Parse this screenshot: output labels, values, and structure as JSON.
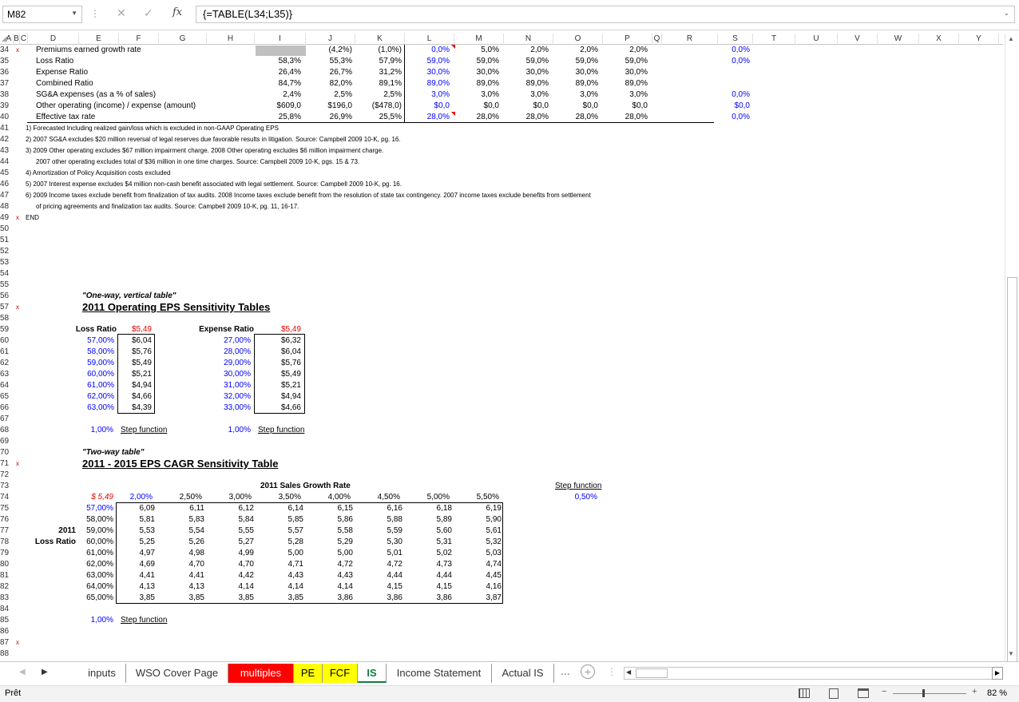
{
  "namebox": "M82",
  "formula": "{=TABLE(L34;L35)}",
  "columns": [
    "A",
    "B",
    "C",
    "D",
    "E",
    "F",
    "G",
    "H",
    "I",
    "J",
    "K",
    "L",
    "M",
    "N",
    "O",
    "P",
    "Q",
    "R",
    "S",
    "T",
    "U",
    "V",
    "W",
    "X",
    "Y"
  ],
  "rows": [
    "34",
    "35",
    "36",
    "37",
    "38",
    "39",
    "40",
    "41",
    "42",
    "43",
    "44",
    "45",
    "46",
    "47",
    "48",
    "49",
    "50",
    "51",
    "52",
    "53",
    "54",
    "55",
    "56",
    "57",
    "58",
    "59",
    "60",
    "61",
    "62",
    "63",
    "64",
    "65",
    "66",
    "67",
    "68",
    "69",
    "70",
    "71",
    "72",
    "73",
    "74",
    "75",
    "76",
    "77",
    "78",
    "79",
    "80",
    "81",
    "82",
    "83",
    "84",
    "85",
    "86",
    "87",
    "88"
  ],
  "top": {
    "r34": {
      "label": "Premiums earned growth rate",
      "j": "(4,2%)",
      "k": "(1,0%)",
      "l": "0,0%",
      "m": "5,0%",
      "n": "2,0%",
      "o": "2,0%",
      "p": "2,0%",
      "s": "0,0%"
    },
    "r35": {
      "label": "Loss Ratio",
      "i": "58,3%",
      "j": "55,3%",
      "k": "57,9%",
      "l": "59,0%",
      "m": "59,0%",
      "n": "59,0%",
      "o": "59,0%",
      "p": "59,0%",
      "s": "0,0%"
    },
    "r36": {
      "label": "Expense Ratio",
      "i": "26,4%",
      "j": "26,7%",
      "k": "31,2%",
      "l": "30,0%",
      "m": "30,0%",
      "n": "30,0%",
      "o": "30,0%",
      "p": "30,0%"
    },
    "r37": {
      "label": "Combined Ratio",
      "i": "84,7%",
      "j": "82,0%",
      "k": "89,1%",
      "l": "89,0%",
      "m": "89,0%",
      "n": "89,0%",
      "o": "89,0%",
      "p": "89,0%"
    },
    "r38": {
      "label": "SG&A expenses (as a % of sales)",
      "i": "2,4%",
      "j": "2,5%",
      "k": "2,5%",
      "l": "3,0%",
      "m": "3,0%",
      "n": "3,0%",
      "o": "3,0%",
      "p": "3,0%",
      "s": "0,0%"
    },
    "r39": {
      "label": "Other operating (income) / expense (amount)",
      "i": "$609,0",
      "j": "$196,0",
      "k": "($478,0)",
      "l": "$0,0",
      "m": "$0,0",
      "n": "$0,0",
      "o": "$0,0",
      "p": "$0,0",
      "s": "$0,0"
    },
    "r40": {
      "label": "Effective tax rate",
      "i": "25,8%",
      "j": "26,9%",
      "k": "25,5%",
      "l": "28,0%",
      "m": "28,0%",
      "n": "28,0%",
      "o": "28,0%",
      "p": "28,0%",
      "s": "0,0%"
    }
  },
  "notes": [
    "1) Forecasted Including realized gain/loss which is excluded in non-GAAP Operating EPS",
    "2) 2007 SG&A excludes $20 million reversal of legal reserves due favorable results in litigation. Source: Campbell 2009 10-K, pg. 16.",
    "3) 2009 Other operating excludes $67 million impairment charge. 2008 Other operating excludes $6 million impairment charge.",
    "2007 other operating excludes total of $36 million in one time charges.  Source: Campbell 2009 10-K, pgs. 15 & 73.",
    "4) Amortization of Policy Acquisition costs excluded",
    "5) 2007 Interest expense excludes $4 million non-cash benefit associated with legal settlement. Source: Campbell 2009 10-K, pg. 16.",
    "6) 2009 Income taxes exclude benefit from finalization of tax audits. 2008 Income taxes exclude benefit from the resolution of state tax contingency. 2007 income taxes exclude benefits from settlement",
    "of pricing agreements and finalization tax audits.  Source: Campbell 2009 10-K, pg. 11, 16-17."
  ],
  "end_label": "END",
  "oneway": {
    "caption": "\"One-way, vertical table\"",
    "title": "2011 Operating EPS Sensitivity Tables",
    "loss": {
      "header": "Loss Ratio",
      "base": "$5,49",
      "rates": [
        "57,00%",
        "58,00%",
        "59,00%",
        "60,00%",
        "61,00%",
        "62,00%",
        "63,00%"
      ],
      "values": [
        "$6,04",
        "$5,76",
        "$5,49",
        "$5,21",
        "$4,94",
        "$4,66",
        "$4,39"
      ],
      "step": "1,00%",
      "step_label": "Step function"
    },
    "expense": {
      "header": "Expense Ratio",
      "base": "$5,49",
      "rates": [
        "27,00%",
        "28,00%",
        "29,00%",
        "30,00%",
        "31,00%",
        "32,00%",
        "33,00%"
      ],
      "values": [
        "$6,32",
        "$6,04",
        "$5,76",
        "$5,49",
        "$5,21",
        "$4,94",
        "$4,66"
      ],
      "step": "1,00%",
      "step_label": "Step function"
    }
  },
  "twoway": {
    "caption": "\"Two-way table\"",
    "title": "2011 - 2015 EPS CAGR Sensitivity Table",
    "col_title": "2011 Sales Growth Rate",
    "row_title_1": "2011",
    "row_title_2": "Loss Ratio",
    "corner": "$ 5,49",
    "growth": [
      "2,00%",
      "2,50%",
      "3,00%",
      "3,50%",
      "4,00%",
      "4,50%",
      "5,00%",
      "5,50%"
    ],
    "loss": [
      "57,00%",
      "58,00%",
      "59,00%",
      "60,00%",
      "61,00%",
      "62,00%",
      "63,00%",
      "64,00%",
      "65,00%"
    ],
    "grid": [
      [
        "6,09",
        "6,11",
        "6,12",
        "6,14",
        "6,15",
        "6,16",
        "6,18",
        "6,19"
      ],
      [
        "5,81",
        "5,83",
        "5,84",
        "5,85",
        "5,86",
        "5,88",
        "5,89",
        "5,90"
      ],
      [
        "5,53",
        "5,54",
        "5,55",
        "5,57",
        "5,58",
        "5,59",
        "5,60",
        "5,61"
      ],
      [
        "5,25",
        "5,26",
        "5,27",
        "5,28",
        "5,29",
        "5,30",
        "5,31",
        "5,32"
      ],
      [
        "4,97",
        "4,98",
        "4,99",
        "5,00",
        "5,00",
        "5,01",
        "5,02",
        "5,03"
      ],
      [
        "4,69",
        "4,70",
        "4,70",
        "4,71",
        "4,72",
        "4,72",
        "4,73",
        "4,74"
      ],
      [
        "4,41",
        "4,41",
        "4,42",
        "4,43",
        "4,43",
        "4,44",
        "4,44",
        "4,45"
      ],
      [
        "4,13",
        "4,13",
        "4,14",
        "4,14",
        "4,14",
        "4,15",
        "4,15",
        "4,16"
      ],
      [
        "3,85",
        "3,85",
        "3,85",
        "3,85",
        "3,86",
        "3,86",
        "3,86",
        "3,87"
      ]
    ],
    "step_row": "1,00%",
    "step_row_label": "Step function",
    "step_col_label": "Step function",
    "step_col": "0,50%"
  },
  "tabs": [
    {
      "label": "inputs",
      "bg": "#ffffff",
      "fg": "#333333"
    },
    {
      "label": "WSO Cover Page",
      "bg": "#ffffff",
      "fg": "#333333"
    },
    {
      "label": "multiples",
      "bg": "#ff0000",
      "fg": "#ffffff"
    },
    {
      "label": "PE",
      "bg": "#ffff00",
      "fg": "#000000"
    },
    {
      "label": "FCF",
      "bg": "#ffff00",
      "fg": "#000000"
    },
    {
      "label": "IS",
      "bg": "#ffffff",
      "fg": "#107c41"
    },
    {
      "label": "Income Statement",
      "bg": "#ffffff",
      "fg": "#333333"
    },
    {
      "label": "Actual IS",
      "bg": "#ffffff",
      "fg": "#333333"
    }
  ],
  "tab_more": "...",
  "status": "Prêt",
  "zoom": "82 %"
}
